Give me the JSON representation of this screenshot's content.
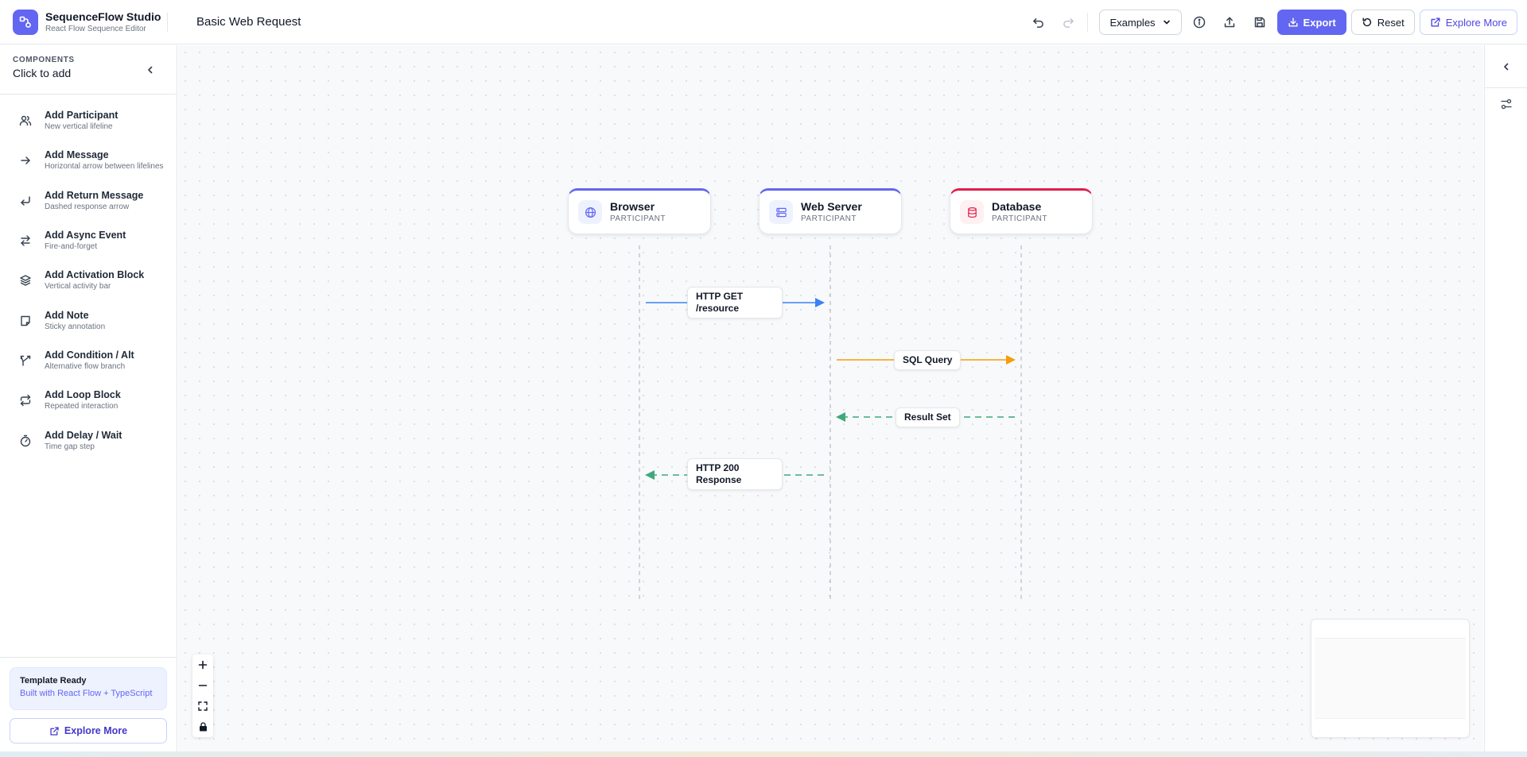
{
  "app": {
    "title": "SequenceFlow Studio",
    "subtitle": "React Flow Sequence Editor",
    "document_title": "Basic Web Request"
  },
  "toolbar": {
    "examples_label": "Examples",
    "export_label": "Export",
    "reset_label": "Reset",
    "explore_label": "Explore More",
    "icons": [
      "undo-icon",
      "redo-icon",
      "info-icon",
      "upload-icon",
      "save-icon"
    ]
  },
  "sidebar": {
    "kicker": "COMPONENTS",
    "heading": "Click to add",
    "items": [
      {
        "title": "Add Participant",
        "desc": "New vertical lifeline",
        "icon": "users-icon"
      },
      {
        "title": "Add Message",
        "desc": "Horizontal arrow between lifelines",
        "icon": "arrow-right-icon"
      },
      {
        "title": "Add Return Message",
        "desc": "Dashed response arrow",
        "icon": "return-arrow-icon"
      },
      {
        "title": "Add Async Event",
        "desc": "Fire-and-forget",
        "icon": "swap-arrows-icon"
      },
      {
        "title": "Add Activation Block",
        "desc": "Vertical activity bar",
        "icon": "layers-icon"
      },
      {
        "title": "Add Note",
        "desc": "Sticky annotation",
        "icon": "sticky-note-icon"
      },
      {
        "title": "Add Condition / Alt",
        "desc": "Alternative flow branch",
        "icon": "split-icon"
      },
      {
        "title": "Add Loop Block",
        "desc": "Repeated interaction",
        "icon": "repeat-icon"
      },
      {
        "title": "Add Delay / Wait",
        "desc": "Time gap step",
        "icon": "timer-icon"
      }
    ],
    "footer": {
      "card_title": "Template Ready",
      "card_sub": "Built with React Flow + TypeScript",
      "explore_label": "Explore More"
    }
  },
  "diagram": {
    "participants": [
      {
        "name": "Browser",
        "role": "PARTICIPANT",
        "icon": "globe-icon",
        "accent": "#6366f1"
      },
      {
        "name": "Web Server",
        "role": "PARTICIPANT",
        "icon": "server-icon",
        "accent": "#6366f1"
      },
      {
        "name": "Database",
        "role": "PARTICIPANT",
        "icon": "database-icon",
        "accent": "#e11d48"
      }
    ],
    "messages": [
      {
        "line1": "HTTP GET",
        "line2": "/resource",
        "color": "#3b82f6",
        "style": "solid"
      },
      {
        "line1": "SQL Query",
        "line2": "",
        "color": "#f59e0b",
        "style": "solid"
      },
      {
        "line1": "Result Set",
        "line2": "",
        "color": "#3fa97a",
        "style": "dashed"
      },
      {
        "line1": "HTTP 200",
        "line2": "Response",
        "color": "#3fa97a",
        "style": "dashed"
      }
    ]
  },
  "colors": {
    "accent": "#6366f1",
    "request": "#3b82f6",
    "query": "#f59e0b",
    "response": "#3fa97a"
  }
}
